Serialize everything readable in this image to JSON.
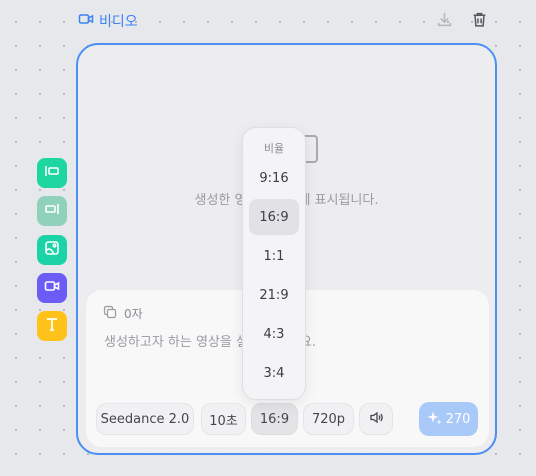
{
  "header": {
    "title": "비디오"
  },
  "preview": {
    "text": "생성한 영상이 여기에 표시됩니다."
  },
  "prompt": {
    "char_count": "0자",
    "placeholder": "생성하고자 하는 영상을 설명해 주세요."
  },
  "toolbar": {
    "model": "Seedance 2.0",
    "duration": "10초",
    "ratio": "16:9",
    "resolution": "720p",
    "credits": "270"
  },
  "ratio_menu": {
    "title": "비율",
    "options": [
      "9:16",
      "16:9",
      "1:1",
      "21:9",
      "4:3",
      "3:4"
    ],
    "selected": "16:9"
  },
  "colors": {
    "accent": "#4b8ff5",
    "generate_button": "#a9caf8",
    "side_icons": [
      "#1dd6a0",
      "#8fd1bb",
      "#1cd3a8",
      "#6b5cf6",
      "#ffc21a"
    ]
  }
}
